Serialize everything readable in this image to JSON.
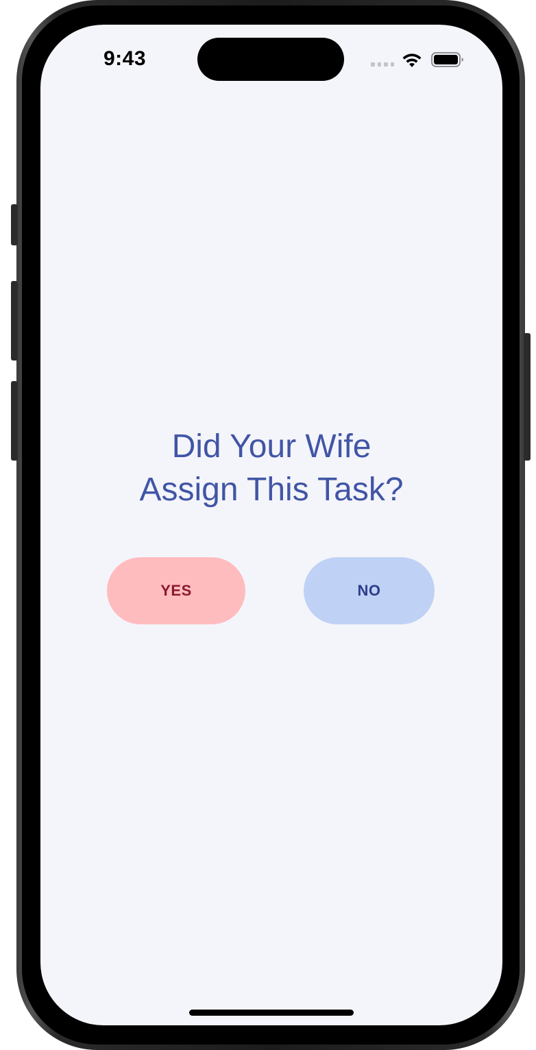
{
  "status_bar": {
    "time": "9:43",
    "icons": [
      "cellular-signal-icon",
      "wifi-icon",
      "battery-icon"
    ]
  },
  "prompt": {
    "line1": "Did Your Wife",
    "line2": "Assign This Task?"
  },
  "buttons": {
    "yes_label": "YES",
    "no_label": "NO"
  },
  "colors": {
    "background": "#f4f5fa",
    "question_text": "#4155a6",
    "yes_bg": "#ffbcbf",
    "yes_text": "#8b1a2e",
    "no_bg": "#bfd1f5",
    "no_text": "#2d3d8a"
  }
}
